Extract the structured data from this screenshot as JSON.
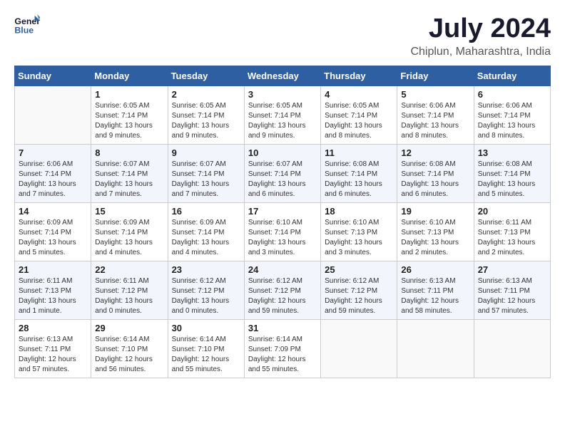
{
  "header": {
    "logo_general": "General",
    "logo_blue": "Blue",
    "month_year": "July 2024",
    "location": "Chiplun, Maharashtra, India"
  },
  "weekdays": [
    "Sunday",
    "Monday",
    "Tuesday",
    "Wednesday",
    "Thursday",
    "Friday",
    "Saturday"
  ],
  "weeks": [
    [
      {
        "day": "",
        "info": ""
      },
      {
        "day": "1",
        "info": "Sunrise: 6:05 AM\nSunset: 7:14 PM\nDaylight: 13 hours and 9 minutes."
      },
      {
        "day": "2",
        "info": "Sunrise: 6:05 AM\nSunset: 7:14 PM\nDaylight: 13 hours and 9 minutes."
      },
      {
        "day": "3",
        "info": "Sunrise: 6:05 AM\nSunset: 7:14 PM\nDaylight: 13 hours and 9 minutes."
      },
      {
        "day": "4",
        "info": "Sunrise: 6:05 AM\nSunset: 7:14 PM\nDaylight: 13 hours and 8 minutes."
      },
      {
        "day": "5",
        "info": "Sunrise: 6:06 AM\nSunset: 7:14 PM\nDaylight: 13 hours and 8 minutes."
      },
      {
        "day": "6",
        "info": "Sunrise: 6:06 AM\nSunset: 7:14 PM\nDaylight: 13 hours and 8 minutes."
      }
    ],
    [
      {
        "day": "7",
        "info": "Sunrise: 6:06 AM\nSunset: 7:14 PM\nDaylight: 13 hours and 7 minutes."
      },
      {
        "day": "8",
        "info": "Sunrise: 6:07 AM\nSunset: 7:14 PM\nDaylight: 13 hours and 7 minutes."
      },
      {
        "day": "9",
        "info": "Sunrise: 6:07 AM\nSunset: 7:14 PM\nDaylight: 13 hours and 7 minutes."
      },
      {
        "day": "10",
        "info": "Sunrise: 6:07 AM\nSunset: 7:14 PM\nDaylight: 13 hours and 6 minutes."
      },
      {
        "day": "11",
        "info": "Sunrise: 6:08 AM\nSunset: 7:14 PM\nDaylight: 13 hours and 6 minutes."
      },
      {
        "day": "12",
        "info": "Sunrise: 6:08 AM\nSunset: 7:14 PM\nDaylight: 13 hours and 6 minutes."
      },
      {
        "day": "13",
        "info": "Sunrise: 6:08 AM\nSunset: 7:14 PM\nDaylight: 13 hours and 5 minutes."
      }
    ],
    [
      {
        "day": "14",
        "info": "Sunrise: 6:09 AM\nSunset: 7:14 PM\nDaylight: 13 hours and 5 minutes."
      },
      {
        "day": "15",
        "info": "Sunrise: 6:09 AM\nSunset: 7:14 PM\nDaylight: 13 hours and 4 minutes."
      },
      {
        "day": "16",
        "info": "Sunrise: 6:09 AM\nSunset: 7:14 PM\nDaylight: 13 hours and 4 minutes."
      },
      {
        "day": "17",
        "info": "Sunrise: 6:10 AM\nSunset: 7:14 PM\nDaylight: 13 hours and 3 minutes."
      },
      {
        "day": "18",
        "info": "Sunrise: 6:10 AM\nSunset: 7:13 PM\nDaylight: 13 hours and 3 minutes."
      },
      {
        "day": "19",
        "info": "Sunrise: 6:10 AM\nSunset: 7:13 PM\nDaylight: 13 hours and 2 minutes."
      },
      {
        "day": "20",
        "info": "Sunrise: 6:11 AM\nSunset: 7:13 PM\nDaylight: 13 hours and 2 minutes."
      }
    ],
    [
      {
        "day": "21",
        "info": "Sunrise: 6:11 AM\nSunset: 7:13 PM\nDaylight: 13 hours and 1 minute."
      },
      {
        "day": "22",
        "info": "Sunrise: 6:11 AM\nSunset: 7:12 PM\nDaylight: 13 hours and 0 minutes."
      },
      {
        "day": "23",
        "info": "Sunrise: 6:12 AM\nSunset: 7:12 PM\nDaylight: 13 hours and 0 minutes."
      },
      {
        "day": "24",
        "info": "Sunrise: 6:12 AM\nSunset: 7:12 PM\nDaylight: 12 hours and 59 minutes."
      },
      {
        "day": "25",
        "info": "Sunrise: 6:12 AM\nSunset: 7:12 PM\nDaylight: 12 hours and 59 minutes."
      },
      {
        "day": "26",
        "info": "Sunrise: 6:13 AM\nSunset: 7:11 PM\nDaylight: 12 hours and 58 minutes."
      },
      {
        "day": "27",
        "info": "Sunrise: 6:13 AM\nSunset: 7:11 PM\nDaylight: 12 hours and 57 minutes."
      }
    ],
    [
      {
        "day": "28",
        "info": "Sunrise: 6:13 AM\nSunset: 7:11 PM\nDaylight: 12 hours and 57 minutes."
      },
      {
        "day": "29",
        "info": "Sunrise: 6:14 AM\nSunset: 7:10 PM\nDaylight: 12 hours and 56 minutes."
      },
      {
        "day": "30",
        "info": "Sunrise: 6:14 AM\nSunset: 7:10 PM\nDaylight: 12 hours and 55 minutes."
      },
      {
        "day": "31",
        "info": "Sunrise: 6:14 AM\nSunset: 7:09 PM\nDaylight: 12 hours and 55 minutes."
      },
      {
        "day": "",
        "info": ""
      },
      {
        "day": "",
        "info": ""
      },
      {
        "day": "",
        "info": ""
      }
    ]
  ]
}
